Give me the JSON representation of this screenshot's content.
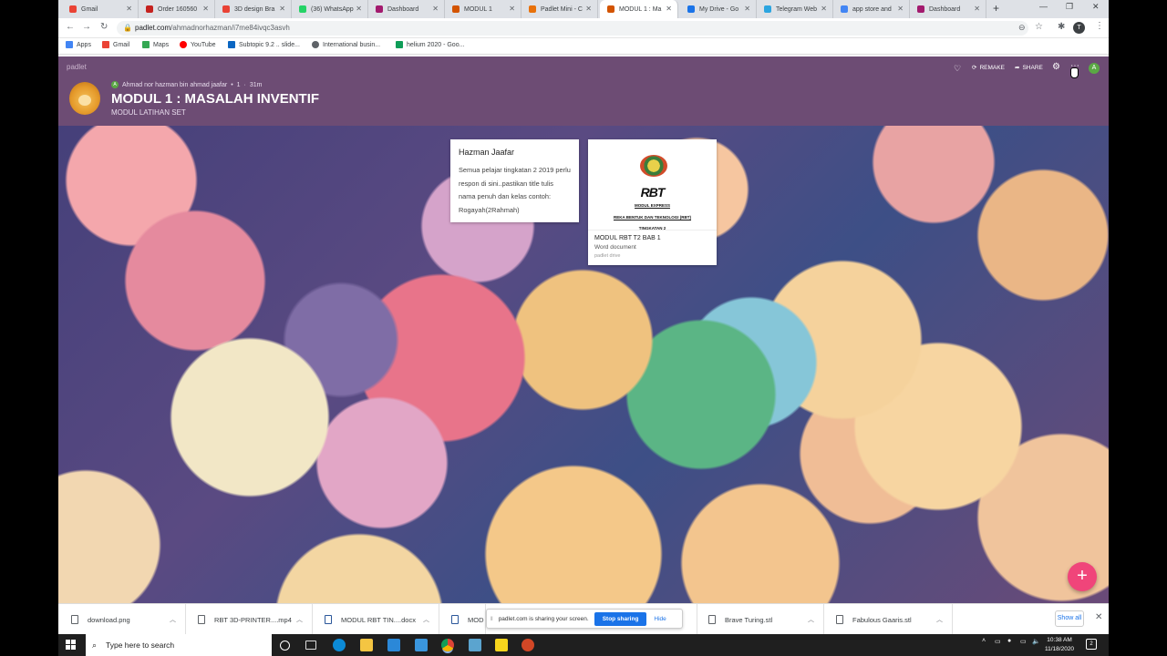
{
  "browser": {
    "tabs": [
      {
        "label": "Gmail",
        "color": "#ea4335"
      },
      {
        "label": "Order 160560",
        "color": "#c5221f"
      },
      {
        "label": "3D design Bra",
        "color": "#e94235"
      },
      {
        "label": "(36) WhatsApp",
        "color": "#25d366"
      },
      {
        "label": "Dashboard",
        "color": "#a31a6e"
      },
      {
        "label": "MODUL 1",
        "color": "#d35400"
      },
      {
        "label": "Padlet Mini - C",
        "color": "#e8710a"
      },
      {
        "label": "MODUL 1 : Ma",
        "color": "#d35400"
      },
      {
        "label": "My Drive - Go",
        "color": "#1a73e8"
      },
      {
        "label": "Telegram Web",
        "color": "#2ca5e0"
      },
      {
        "label": "app store and",
        "color": "#4285f4"
      },
      {
        "label": "Dashboard",
        "color": "#a31a6e"
      }
    ],
    "new_tab": "+",
    "window_controls": [
      "—",
      "❐",
      "✕"
    ],
    "url_host": "padlet.com",
    "url_path": "/ahmadnorhazman/i7me84ivqc3asvh",
    "profile_initial": "T",
    "bookmarks": [
      {
        "label": "Apps",
        "color": "#4285f4"
      },
      {
        "label": "Gmail",
        "color": "#ea4335"
      },
      {
        "label": "Maps",
        "color": "#34a853"
      },
      {
        "label": "YouTube",
        "color": "#ff0000"
      },
      {
        "label": "Subtopic 9.2 .. slide...",
        "color": "#0a66c2"
      },
      {
        "label": "International busin...",
        "color": "#5f6368"
      },
      {
        "label": "helium 2020 - Goo...",
        "color": "#0f9d58"
      }
    ]
  },
  "padlet": {
    "brand": "padlet",
    "author": "Ahmad nor hazman bin ahmad jaafar",
    "author_initial": "A",
    "likes": "1",
    "age": "31m",
    "title": "MODUL 1 : MASALAH INVENTIF",
    "subtitle": "MODUL LATIHAN SET",
    "actions": {
      "remake": "REMAKE",
      "share": "SHARE"
    },
    "user_initial": "A",
    "fab": "+",
    "posts": [
      {
        "title": "Hazman Jaafar",
        "body": "Semua pelajar tingkatan 2 2019 perlu respon di sini..pastikan title tulis nama penuh dan kelas contoh: Rogayah(2Rahmah)"
      },
      {
        "thumb_logo": "RBT",
        "thumb_line1": "MODUL EXPRESS",
        "thumb_line2": "REKA BENTUK DAN TEKNOLOGI (RBT)",
        "thumb_line3": "TINGKATAN 2",
        "file_name": "MODUL RBT T2 BAB 1",
        "file_type": "Word document",
        "file_source": "padlet drive"
      }
    ]
  },
  "downloads": {
    "items": [
      {
        "name": "download.png"
      },
      {
        "name": "RBT 3D-PRINTER....mp4"
      },
      {
        "name": "MODUL RBT TIN....docx"
      },
      {
        "name": "MOD"
      },
      {
        "name": "Brave Turing.stl"
      },
      {
        "name": "Fabulous Gaaris.stl"
      }
    ],
    "share_notice": "padlet.com is sharing your screen.",
    "stop_sharing": "Stop sharing",
    "hide": "Hide",
    "show_all": "Show all"
  },
  "taskbar": {
    "search_placeholder": "Type here to search",
    "time": "10:38 AM",
    "date": "11/18/2020",
    "notifications": "2",
    "apps": [
      {
        "name": "task-view",
        "color": "#ffffff"
      },
      {
        "name": "edge",
        "color": "#0c8ad6"
      },
      {
        "name": "file-explorer",
        "color": "#f4c542"
      },
      {
        "name": "store",
        "color": "#2b88d8"
      },
      {
        "name": "mail",
        "color": "#3a96dd"
      },
      {
        "name": "chrome",
        "color": "#db4437"
      },
      {
        "name": "generic-app",
        "color": "#5ba4cf"
      },
      {
        "name": "sticky-notes",
        "color": "#f7d51d"
      },
      {
        "name": "powerpoint",
        "color": "#d24726"
      }
    ]
  }
}
